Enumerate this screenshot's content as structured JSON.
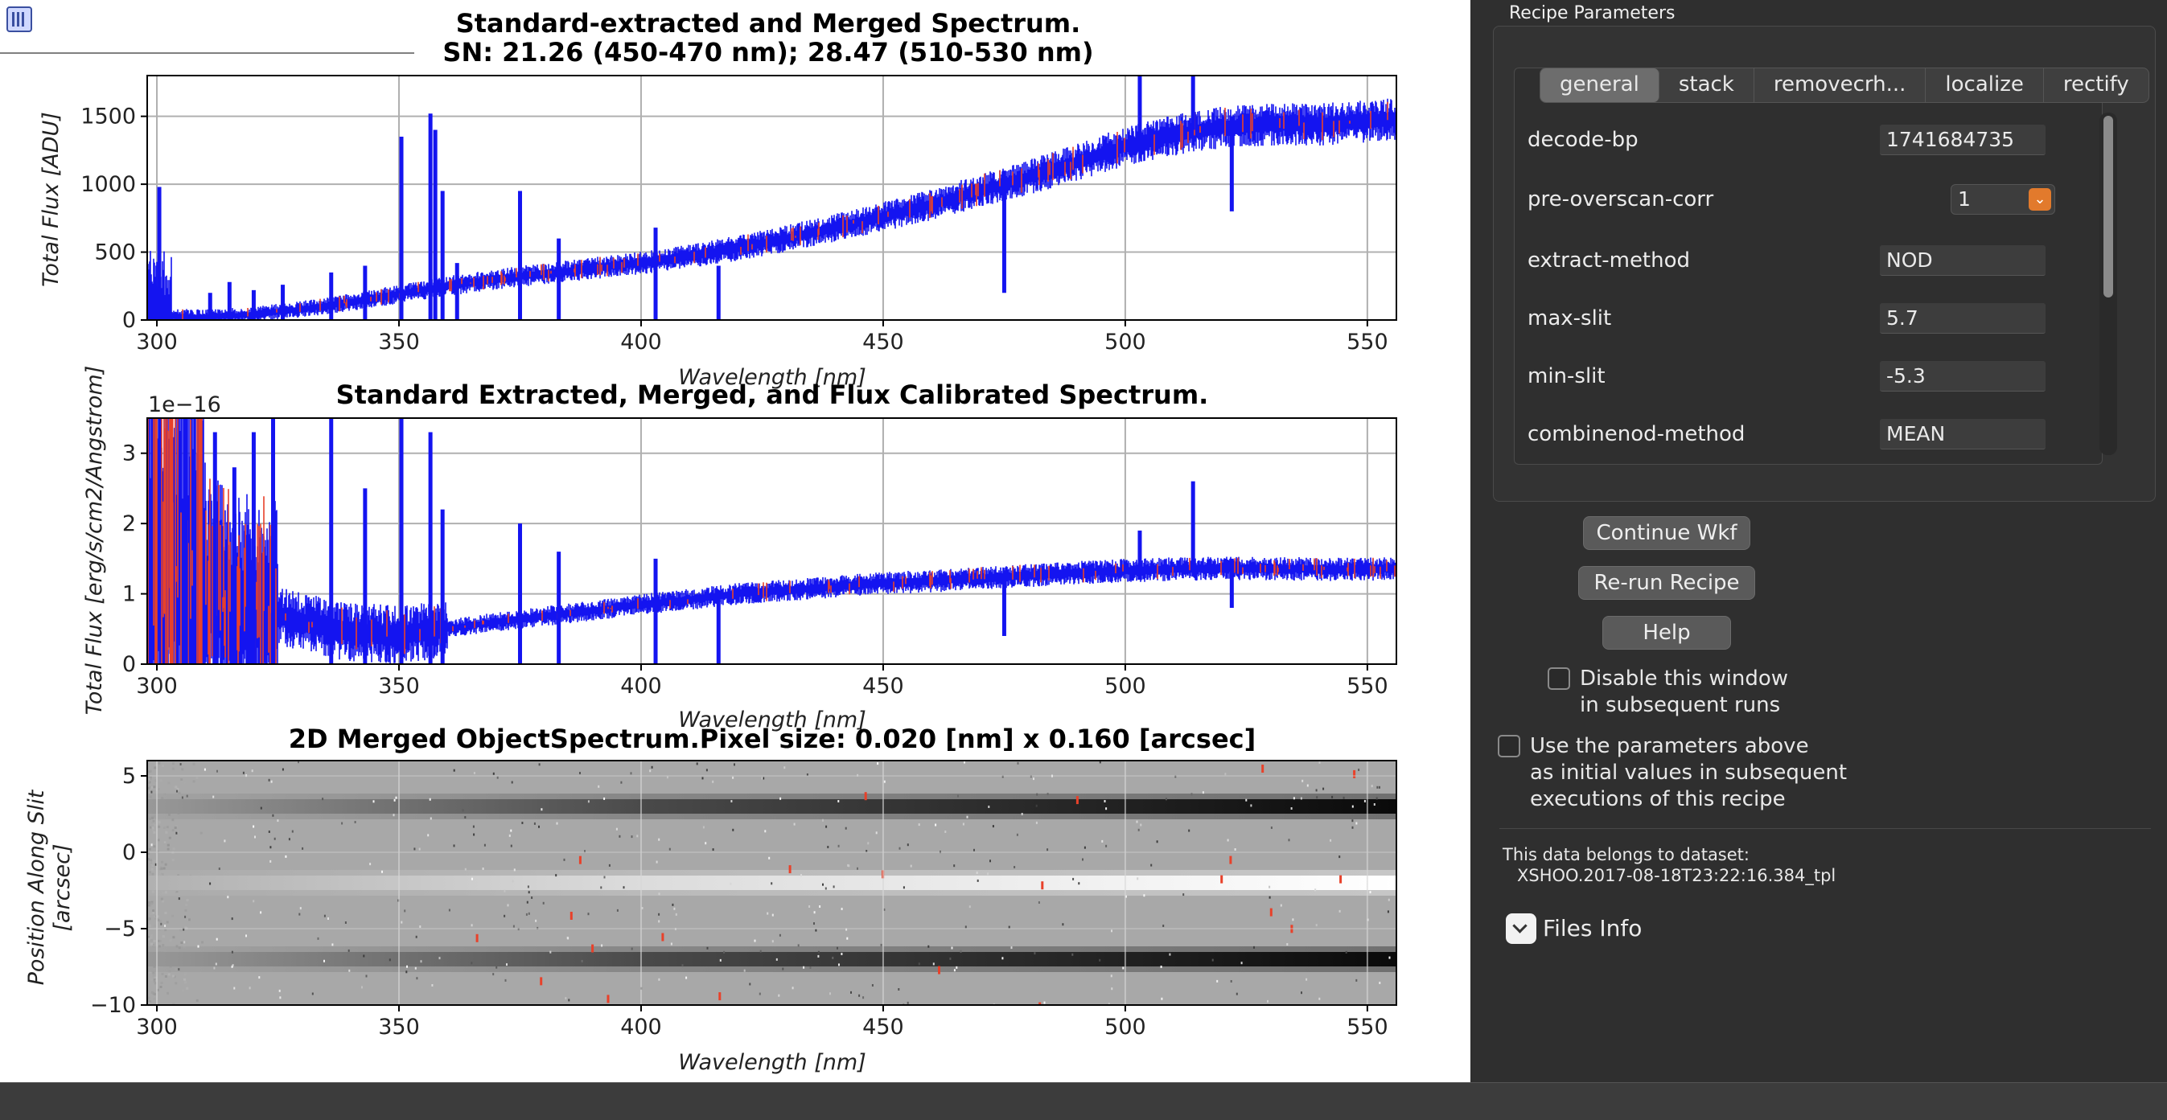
{
  "plots": {
    "top": {
      "title_line1": "Standard-extracted and Merged Spectrum.",
      "title_line2": "SN: 21.26 (450-470 nm); 28.47 (510-530 nm)",
      "xlabel": "Wavelength [nm]",
      "ylabel": "Total Flux [ADU]",
      "yticks": [
        "0",
        "500",
        "1000",
        "1500"
      ],
      "xticks": [
        "300",
        "350",
        "400",
        "450",
        "500",
        "550"
      ]
    },
    "middle": {
      "title": "Standard Extracted, Merged, and Flux Calibrated Spectrum.",
      "xlabel": "Wavelength [nm]",
      "ylabel": "Total Flux [erg/s/cm2/Angstrom]",
      "offset_label": "1e−16",
      "yticks": [
        "0",
        "1",
        "2",
        "3"
      ],
      "xticks": [
        "300",
        "350",
        "400",
        "450",
        "500",
        "550"
      ]
    },
    "bottom": {
      "title": "2D Merged ObjectSpectrum.Pixel size: 0.020 [nm] x 0.160 [arcsec]",
      "xlabel": "Wavelength [nm]",
      "ylabel_line1": "Position Along Slit",
      "ylabel_line2": "[arcsec]",
      "yticks": [
        "5",
        "0",
        "−5",
        "−10"
      ],
      "xticks": [
        "300",
        "350",
        "400",
        "450",
        "500",
        "550"
      ]
    }
  },
  "chart_data": [
    {
      "type": "line",
      "title": "Standard-extracted and Merged Spectrum.",
      "subtitle": "SN: 21.26 (450-470 nm); 28.47 (510-530 nm)",
      "xlabel": "Wavelength [nm]",
      "ylabel": "Total Flux [ADU]",
      "xlim": [
        298,
        556
      ],
      "ylim": [
        0,
        1800
      ],
      "grid": true,
      "colors": {
        "spectrum": "#1414f0",
        "flagged": "#e8412a"
      },
      "series": [
        {
          "x": [
            300,
            310,
            320,
            330,
            340,
            350,
            360,
            370,
            380,
            390,
            400,
            410,
            420,
            430,
            440,
            450,
            460,
            470,
            480,
            490,
            500,
            510,
            520,
            530,
            540,
            550,
            556
          ],
          "values": [
            30,
            20,
            40,
            80,
            130,
            190,
            250,
            300,
            340,
            380,
            420,
            470,
            530,
            600,
            680,
            760,
            850,
            950,
            1050,
            1160,
            1280,
            1360,
            1420,
            1440,
            1440,
            1460,
            1480
          ]
        }
      ]
    },
    {
      "type": "line",
      "title": "Standard Extracted, Merged, and Flux Calibrated Spectrum.",
      "xlabel": "Wavelength [nm]",
      "ylabel": "Total Flux [erg/s/cm2/Angstrom]",
      "y_scale_factor": "1e-16",
      "xlim": [
        298,
        556
      ],
      "ylim": [
        0,
        3.5
      ],
      "grid": true,
      "colors": {
        "spectrum": "#1414f0",
        "flagged": "#e8412a"
      },
      "series": [
        {
          "x": [
            300,
            310,
            320,
            330,
            340,
            350,
            360,
            370,
            380,
            390,
            400,
            410,
            420,
            430,
            440,
            450,
            460,
            470,
            480,
            490,
            500,
            510,
            520,
            530,
            540,
            550,
            556
          ],
          "values": [
            1.6,
            1.0,
            0.8,
            0.6,
            0.45,
            0.42,
            0.5,
            0.6,
            0.68,
            0.76,
            0.85,
            0.92,
            1.0,
            1.05,
            1.1,
            1.15,
            1.18,
            1.22,
            1.26,
            1.3,
            1.33,
            1.35,
            1.36,
            1.36,
            1.35,
            1.35,
            1.36
          ]
        }
      ]
    },
    {
      "type": "heatmap",
      "title": "2D Merged ObjectSpectrum.Pixel size: 0.020 [nm] x 0.160 [arcsec]",
      "xlabel": "Wavelength [nm]",
      "ylabel": "Position Along Slit [arcsec]",
      "xlim": [
        298,
        556
      ],
      "ylim": [
        -10,
        6
      ],
      "colormap": "gray",
      "features": [
        {
          "kind": "dark trace",
          "position_arcsec": 3
        },
        {
          "kind": "bright trace",
          "position_arcsec": -2
        },
        {
          "kind": "dark trace",
          "position_arcsec": -7
        }
      ]
    }
  ],
  "panel": {
    "title": "Recipe Parameters",
    "tabs": [
      "general",
      "stack",
      "removecrh...",
      "localize",
      "rectify"
    ],
    "params": [
      {
        "label": "decode-bp",
        "value": "1741684735"
      },
      {
        "label": "pre-overscan-corr",
        "value": "1"
      },
      {
        "label": "extract-method",
        "value": "NOD"
      },
      {
        "label": "max-slit",
        "value": "5.7"
      },
      {
        "label": "min-slit",
        "value": "-5.3"
      },
      {
        "label": "combinenod-method",
        "value": "MEAN"
      }
    ],
    "buttons": {
      "continue": "Continue Wkf",
      "rerun": "Re-run Recipe",
      "help": "Help"
    },
    "disable_window": {
      "line1": "Disable this window",
      "line2": "in subsequent runs"
    },
    "use_params": {
      "line1": "Use the parameters above",
      "line2": "as initial values in subsequent",
      "line3": "executions of this recipe"
    },
    "dataset_label": "This data belongs to dataset:",
    "dataset_id": "XSHOO.2017-08-18T23:22:16.384_tpl",
    "files_info": "Files Info"
  }
}
